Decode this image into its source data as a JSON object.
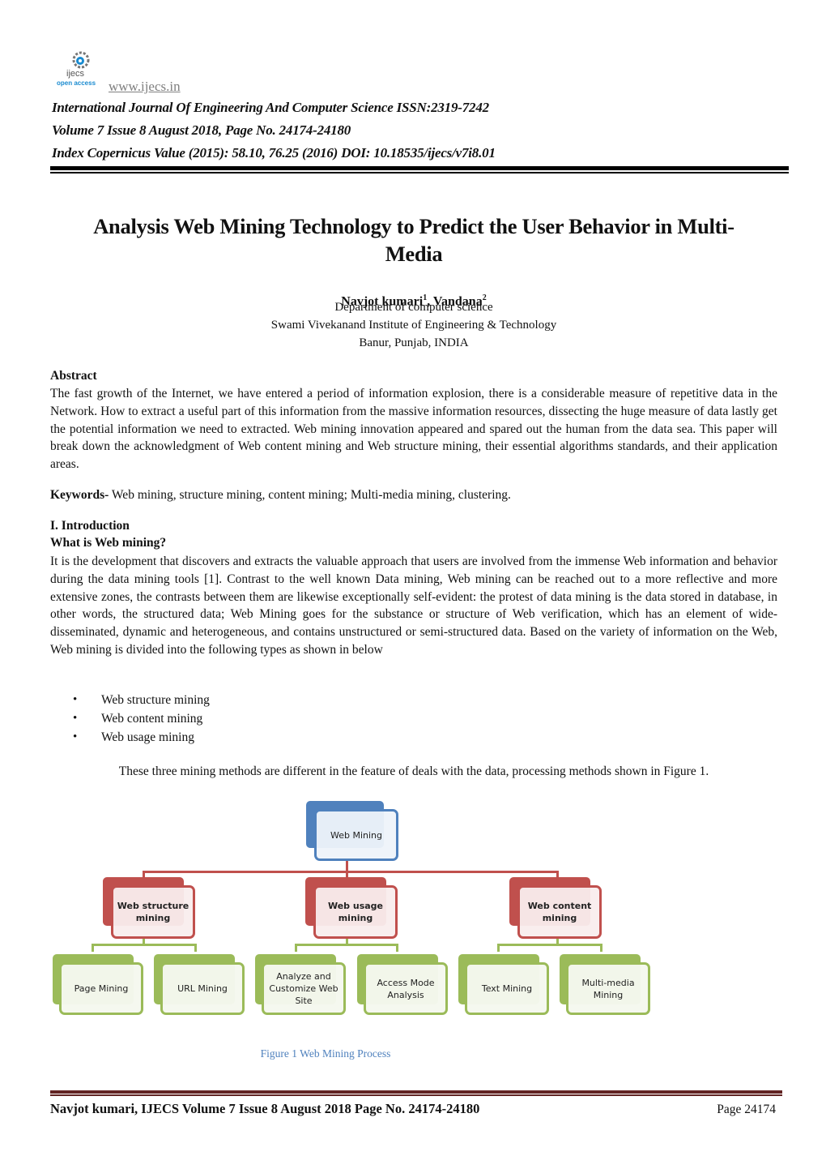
{
  "header": {
    "logo_name": "ijecs",
    "logo_tagline": "open access",
    "site_url": "www.ijecs.in",
    "journal_title": "International Journal Of Engineering And Computer Science ISSN:2319-7242",
    "volume_line": "Volume 7 Issue 8 August 2018, Page No. 24174-24180",
    "index_line": "Index Copernicus Value (2015): 58.10, 76.25 (2016) DOI: 10.18535/ijecs/v7i8.01"
  },
  "paper": {
    "title": "Analysis Web Mining Technology to Predict the User Behavior in Multi-Media",
    "title_line1": "Analysis Web Mining Technology to Predict the User Behavior in Multi-",
    "title_line2": "Media",
    "authors": [
      {
        "name": "Navjot kumari",
        "sup": "1"
      },
      {
        "name": "Vandana",
        "sup": "2"
      }
    ],
    "author_separator": ", ",
    "affiliation": [
      "Department of computer science",
      "Swami Vivekanand Institute of Engineering & Technology",
      "Banur, Punjab, INDIA"
    ]
  },
  "abstract": {
    "heading": "Abstract",
    "text": "The fast growth of the Internet, we have entered a period of information explosion, there is a considerable measure of repetitive data in the Network. How to extract a useful part of this information from the massive information resources, dissecting the huge measure of data lastly get the potential information we need to extracted. Web mining innovation appeared and spared out the human from the data sea. This paper will break down the acknowledgment of Web content mining and Web structure mining, their essential algorithms standards, and their application areas."
  },
  "keywords": {
    "label": "Keywords-",
    "text": " Web mining, structure mining, content mining; Multi-media mining, clustering."
  },
  "introduction": {
    "heading": "I. Introduction",
    "subheading": "What is Web mining?",
    "paragraph": "It is the development that discovers and extracts the valuable approach that users are involved from the immense Web information and behavior during the data mining tools [1]. Contrast to the well known Data mining, Web mining can be reached out to a more reflective and more extensive zones, the contrasts between them are likewise exceptionally self-evident: the protest of data mining is the data stored in database, in other words, the structured data; Web Mining goes for the substance or structure of Web verification, which has an element of wide-disseminated, dynamic and heterogeneous, and contains unstructured or semi-structured data. Based on the variety of information on the Web, Web mining is divided into the following types as shown in below",
    "bullets": [
      "Web structure mining",
      "Web content mining",
      "Web usage mining"
    ],
    "figure_reference": "These three mining methods are different in the feature of deals with the data, processing methods shown in Figure 1."
  },
  "figure": {
    "root": "Web Mining",
    "categories": [
      {
        "label": "Web structure mining",
        "children": [
          "Page Mining",
          "URL Mining"
        ]
      },
      {
        "label": "Web usage mining",
        "children": [
          "Analyze and Customize Web Site",
          "Access Mode Analysis"
        ]
      },
      {
        "label": "Web content mining",
        "children": [
          "Text Mining",
          "Multi-media Mining"
        ]
      }
    ],
    "caption": "Figure 1 Web Mining Process",
    "colors": {
      "root": "#4f81bd",
      "category": "#c0504d",
      "leaf": "#9bbb59",
      "caption": "#4f81bd"
    }
  },
  "footer": {
    "citation": "Navjot kumari, IJECS Volume 7 Issue 8 August 2018 Page No. 24174-24180",
    "page_label": "Page 24174",
    "rule_color": "#622423"
  }
}
